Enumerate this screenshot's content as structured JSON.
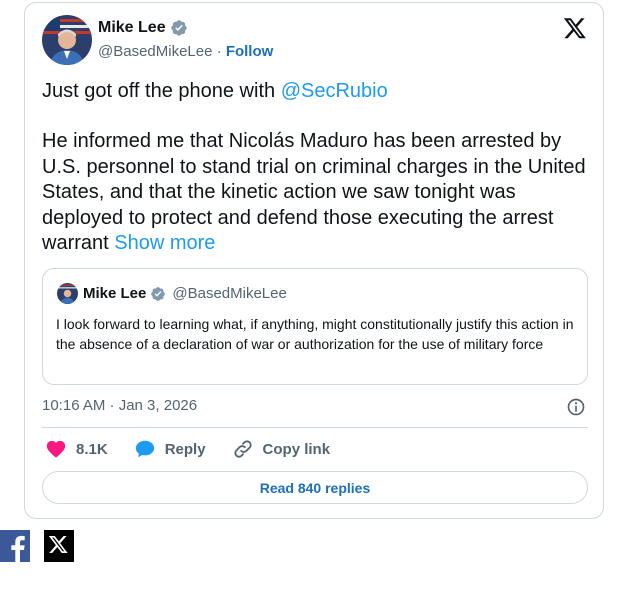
{
  "author": {
    "name": "Mike Lee",
    "handle": "@BasedMikeLee",
    "separator": "·",
    "follow_label": "Follow"
  },
  "tweet": {
    "line1_prefix": "Just got off the phone with ",
    "mention": "@SecRubio",
    "body": "He informed me that Nicolás Maduro has been arrested by U.S. personnel to stand trial on criminal charges in the United States, and that the kinetic action we saw tonight was deployed to protect and defend those executing the arrest warrant",
    "show_more": "Show more"
  },
  "quote": {
    "name": "Mike Lee",
    "handle": "@BasedMikeLee",
    "text": "I look forward to learning what, if anything, might constitutionally justify this action in the absence of a declaration of war or authorization for the use of military force"
  },
  "timestamp": "10:16 AM · Jan 3, 2026",
  "actions": {
    "likes": "8.1K",
    "reply_label": "Reply",
    "copy_link_label": "Copy link"
  },
  "read_replies_label": "Read 840 replies",
  "colors": {
    "link_blue": "#1d9bf0",
    "like_pink": "#f91880",
    "reply_blue": "#1d9bf0",
    "facebook_blue": "#3b5998",
    "verified_gray": "#829aab"
  },
  "icons": {
    "verified": "verified-badge-icon",
    "x_logo": "x-logo-icon",
    "info": "info-icon",
    "like": "heart-icon",
    "reply": "speech-bubble-icon",
    "copy_link": "link-icon",
    "facebook": "facebook-icon",
    "x_share": "x-share-icon"
  }
}
